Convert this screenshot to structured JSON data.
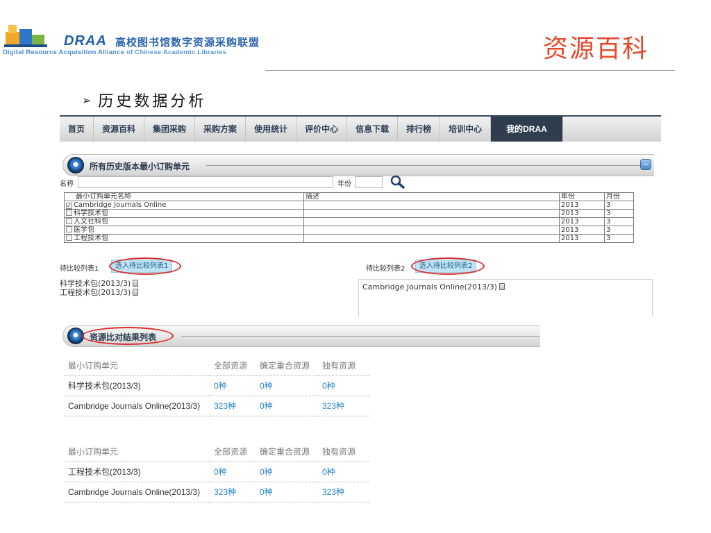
{
  "brand": {
    "name": "DRAA",
    "chinese_name": "高校图书馆数字资源采购联盟",
    "english_prefix": "Digital Resource Acquisition Alliance",
    "english_suffix": "of Chinese Academic Libraries"
  },
  "slide_title": "资源百科",
  "heading": "历史数据分析",
  "nav": {
    "items": [
      "首页",
      "资源百科",
      "集团采购",
      "采购方案",
      "使用统计",
      "评价中心",
      "信息下载",
      "排行榜",
      "培训中心",
      "我的DRAA"
    ],
    "active_index": 9
  },
  "panel1": {
    "title": "所有历史版本最小订购单元",
    "collapse_symbol": "−"
  },
  "filters": {
    "name_label": "名称",
    "name_value": "",
    "year_label": "年份",
    "year_value": ""
  },
  "grid": {
    "headers": [
      "最小订购单元名称",
      "描述",
      "年份",
      "月份"
    ],
    "rows": [
      {
        "name": "Cambridge Journals Online",
        "desc": "",
        "year": "2013",
        "month": "3",
        "checked": true
      },
      {
        "name": "科学技术包",
        "desc": "",
        "year": "2013",
        "month": "3",
        "checked": false
      },
      {
        "name": "人文社科包",
        "desc": "",
        "year": "2013",
        "month": "3",
        "checked": false
      },
      {
        "name": "医学包",
        "desc": "",
        "year": "2013",
        "month": "3",
        "checked": false
      },
      {
        "name": "工程技术包",
        "desc": "",
        "year": "2013",
        "month": "3",
        "checked": false
      }
    ]
  },
  "compare": {
    "list1": {
      "label": "待比较列表1",
      "button": "选入待比较列表1",
      "items": [
        "科学技术包(2013/3)",
        "工程技术包(2013/3)"
      ]
    },
    "list2": {
      "label": "待比较列表2",
      "button": "选入待比较列表2",
      "items": [
        "Cambridge Journals Online(2013/3)"
      ]
    }
  },
  "panel2": {
    "title": "资源比对结果列表"
  },
  "results": [
    {
      "headers": [
        "最小订购单元",
        "全部资源",
        "确定重合资源",
        "独有资源"
      ],
      "rows": [
        [
          "科学技术包(2013/3)",
          "0种",
          "0种",
          "0种"
        ],
        [
          "Cambridge Journals Online(2013/3)",
          "323种",
          "0种",
          "323种"
        ]
      ]
    },
    {
      "headers": [
        "最小订购单元",
        "全部资源",
        "确定重合资源",
        "独有资源"
      ],
      "rows": [
        [
          "工程技术包(2013/3)",
          "0种",
          "0种",
          "0种"
        ],
        [
          "Cambridge Journals Online(2013/3)",
          "323种",
          "0种",
          "323种"
        ]
      ]
    }
  ],
  "colors": {
    "slide_title": "#e8472a",
    "brand_blue": "#1f5fa8",
    "nav_active_bg": "#2f3d4e",
    "link_blue": "#2a86c7",
    "highlight_ellipse": "#d92b2b",
    "compare_button_bg": "#bfe3f5"
  },
  "icons": {
    "search": "magnifier-icon",
    "remove": "trash-icon",
    "panel_orb": "orb-icon",
    "logo": "building-logo-icon"
  }
}
